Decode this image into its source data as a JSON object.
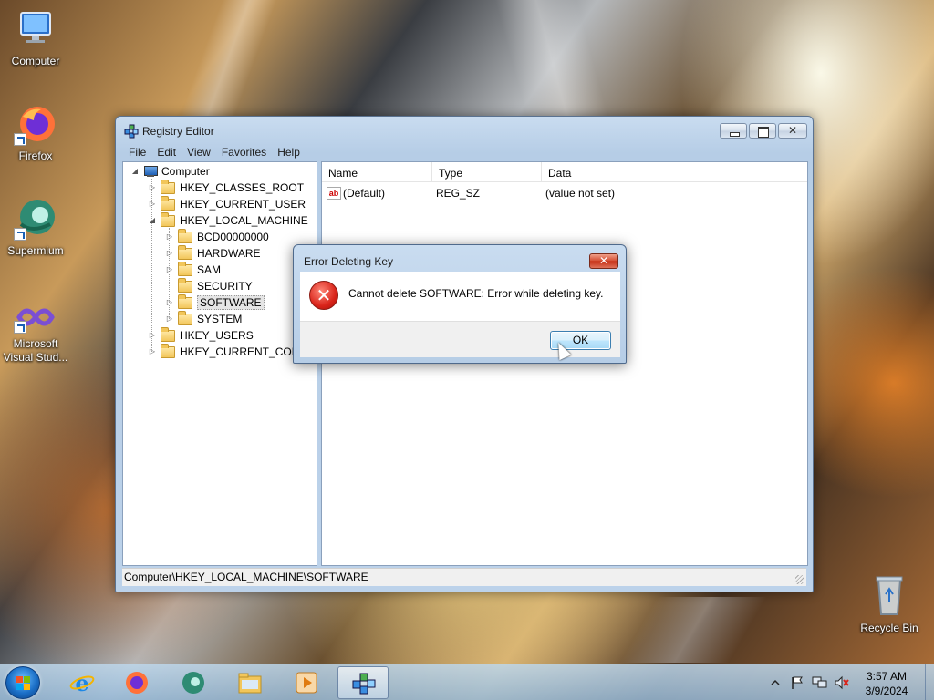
{
  "desktop": {
    "icons": [
      {
        "label": "Computer"
      },
      {
        "label": "Firefox"
      },
      {
        "label": "Supermium"
      },
      {
        "label": "Microsoft Visual Stud..."
      },
      {
        "label": "Recycle Bin"
      }
    ]
  },
  "window": {
    "title": "Registry Editor",
    "menu": [
      "File",
      "Edit",
      "View",
      "Favorites",
      "Help"
    ],
    "tree": {
      "root": "Computer",
      "items": [
        {
          "label": "HKEY_CLASSES_ROOT"
        },
        {
          "label": "HKEY_CURRENT_USER"
        },
        {
          "label": "HKEY_LOCAL_MACHINE"
        },
        {
          "label": "BCD00000000"
        },
        {
          "label": "HARDWARE"
        },
        {
          "label": "SAM"
        },
        {
          "label": "SECURITY"
        },
        {
          "label": "SOFTWARE"
        },
        {
          "label": "SYSTEM"
        },
        {
          "label": "HKEY_USERS"
        },
        {
          "label": "HKEY_CURRENT_CONF"
        }
      ],
      "selected": "SOFTWARE"
    },
    "list": {
      "columns": [
        "Name",
        "Type",
        "Data"
      ],
      "rows": [
        {
          "name": "(Default)",
          "type": "REG_SZ",
          "data": "(value not set)"
        }
      ]
    },
    "status_path": "Computer\\HKEY_LOCAL_MACHINE\\SOFTWARE"
  },
  "dialog": {
    "title": "Error Deleting Key",
    "message": "Cannot delete SOFTWARE:  Error while deleting key.",
    "ok_label": "OK",
    "icon": "error-icon"
  },
  "taskbar": {
    "buttons": [
      {
        "name": "internet-explorer"
      },
      {
        "name": "firefox"
      },
      {
        "name": "supermium"
      },
      {
        "name": "file-explorer"
      },
      {
        "name": "media-player"
      },
      {
        "name": "registry-editor",
        "active": true
      }
    ],
    "clock_time": "3:57 AM",
    "clock_date": "3/9/2024"
  },
  "colors": {
    "accent": "#3c7fb1",
    "error": "#d9241a",
    "folder": "#f2c65a"
  }
}
